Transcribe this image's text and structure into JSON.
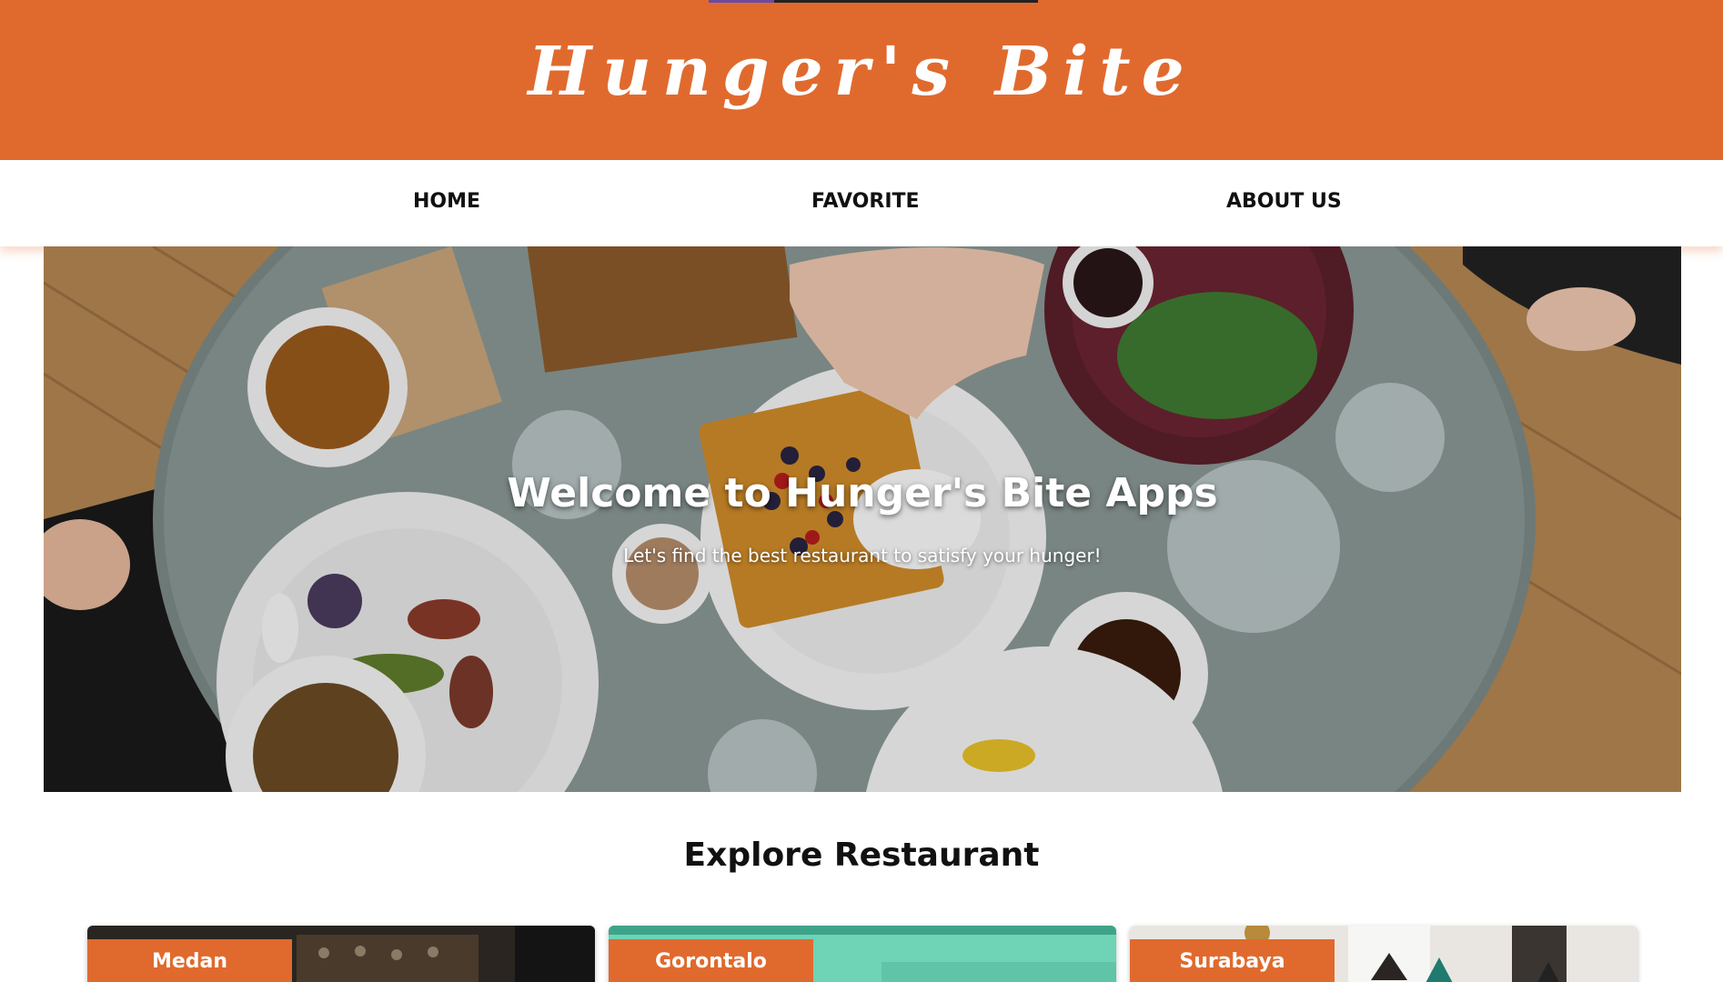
{
  "header": {
    "brand": "Hunger's Bite",
    "color": "#e06a2e"
  },
  "nav": {
    "items": [
      {
        "label": "HOME"
      },
      {
        "label": "FAVORITE"
      },
      {
        "label": "ABOUT US"
      }
    ]
  },
  "hero": {
    "title": "Welcome to Hunger's Bite Apps",
    "subtitle": "Let's find the best restaurant to satisfy your hunger!"
  },
  "explore": {
    "title": "Explore Restaurant",
    "cards": [
      {
        "city": "Medan"
      },
      {
        "city": "Gorontalo"
      },
      {
        "city": "Surabaya"
      }
    ]
  }
}
